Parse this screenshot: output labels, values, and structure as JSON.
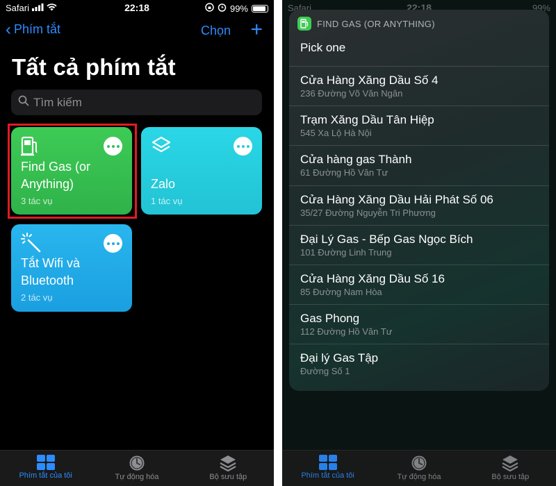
{
  "colors": {
    "accent": "#2d8cff",
    "tile_green": "#34c05a",
    "tile_cyan": "#27cbdb",
    "tile_blue": "#22a9e8",
    "highlight": "#e21b22"
  },
  "status_bar": {
    "carrier": "Safari",
    "time": "22:18",
    "battery": "99%"
  },
  "left_screen": {
    "nav": {
      "back_label": "Phím tắt",
      "select_label": "Chọn",
      "add_icon": "plus-icon"
    },
    "title": "Tất cả phím tắt",
    "search": {
      "placeholder": "Tìm kiếm"
    },
    "shortcuts": [
      {
        "name": "Find Gas (or Anything)",
        "name_line1": "Find Gas (or",
        "name_line2": "Anything)",
        "actions": "3 tác vụ",
        "icon": "fuel-pump-icon",
        "highlighted": true
      },
      {
        "name": "Zalo",
        "actions": "1 tác vụ",
        "icon": "layers-icon",
        "highlighted": false
      },
      {
        "name": "Tắt Wifi và Bluetooth",
        "name_line1": "Tắt Wifi và",
        "name_line2": "Bluetooth",
        "actions": "2 tác vụ",
        "icon": "magic-wand-icon",
        "highlighted": false
      }
    ]
  },
  "right_screen": {
    "picker": {
      "app_name": "FIND GAS (OR ANYTHING)",
      "prompt": "Pick one",
      "items": [
        {
          "title": "Cửa Hàng Xăng Dầu Số 4",
          "subtitle": "236 Đường Võ Văn Ngân"
        },
        {
          "title": "Trạm Xăng Dầu Tân Hiệp",
          "subtitle": "545 Xa Lộ Hà Nội"
        },
        {
          "title": "Cửa hàng gas Thành",
          "subtitle": "61 Đường Hồ Văn Tư"
        },
        {
          "title": "Cửa Hàng Xăng Dầu Hải Phát Số 06",
          "subtitle": "35/27 Đường Nguyễn Tri Phương"
        },
        {
          "title": "Đại Lý Gas - Bếp Gas Ngọc Bích",
          "subtitle": "101 Đường Linh Trung"
        },
        {
          "title": "Cửa Hàng Xăng Dầu Số 16",
          "subtitle": "85 Đường Nam Hòa"
        },
        {
          "title": "Gas Phong",
          "subtitle": "112 Đường Hồ Văn Tư"
        },
        {
          "title": "Đại lý Gas Tập",
          "subtitle": "Đường Số 1"
        }
      ]
    }
  },
  "tab_bar": {
    "tabs": [
      {
        "label": "Phím tắt của tôi",
        "icon": "grid-icon",
        "active": true
      },
      {
        "label": "Tự động hóa",
        "icon": "clock-icon",
        "active": false
      },
      {
        "label": "Bộ sưu tập",
        "icon": "stack-icon",
        "active": false
      }
    ]
  }
}
